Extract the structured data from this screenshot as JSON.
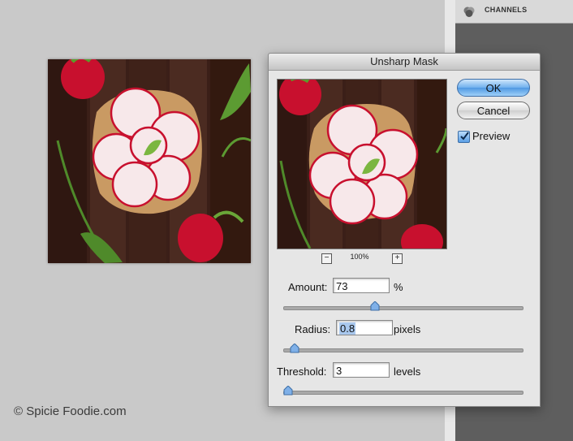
{
  "panel": {
    "channels_label": "CHANNELS"
  },
  "watermark": {
    "text": "© Spicie Foodie.com"
  },
  "dialog": {
    "title": "Unsharp Mask",
    "ok_label": "OK",
    "cancel_label": "Cancel",
    "preview_label": "Preview",
    "preview_checked": true,
    "zoom_minus": "−",
    "zoom_plus": "+",
    "zoom_level": "100%",
    "amount": {
      "label": "Amount:",
      "value": "73",
      "unit": "%",
      "slider_fraction": 0.38
    },
    "radius": {
      "label": "Radius:",
      "value": "0.8",
      "unit": "pixels",
      "slider_fraction": 0.03
    },
    "threshold": {
      "label": "Threshold:",
      "value": "3",
      "unit": "levels",
      "slider_fraction": 0.0
    }
  },
  "colors": {
    "accent": "#5a9fe6",
    "wood": "#3d2018",
    "radish": "#c8102e"
  }
}
